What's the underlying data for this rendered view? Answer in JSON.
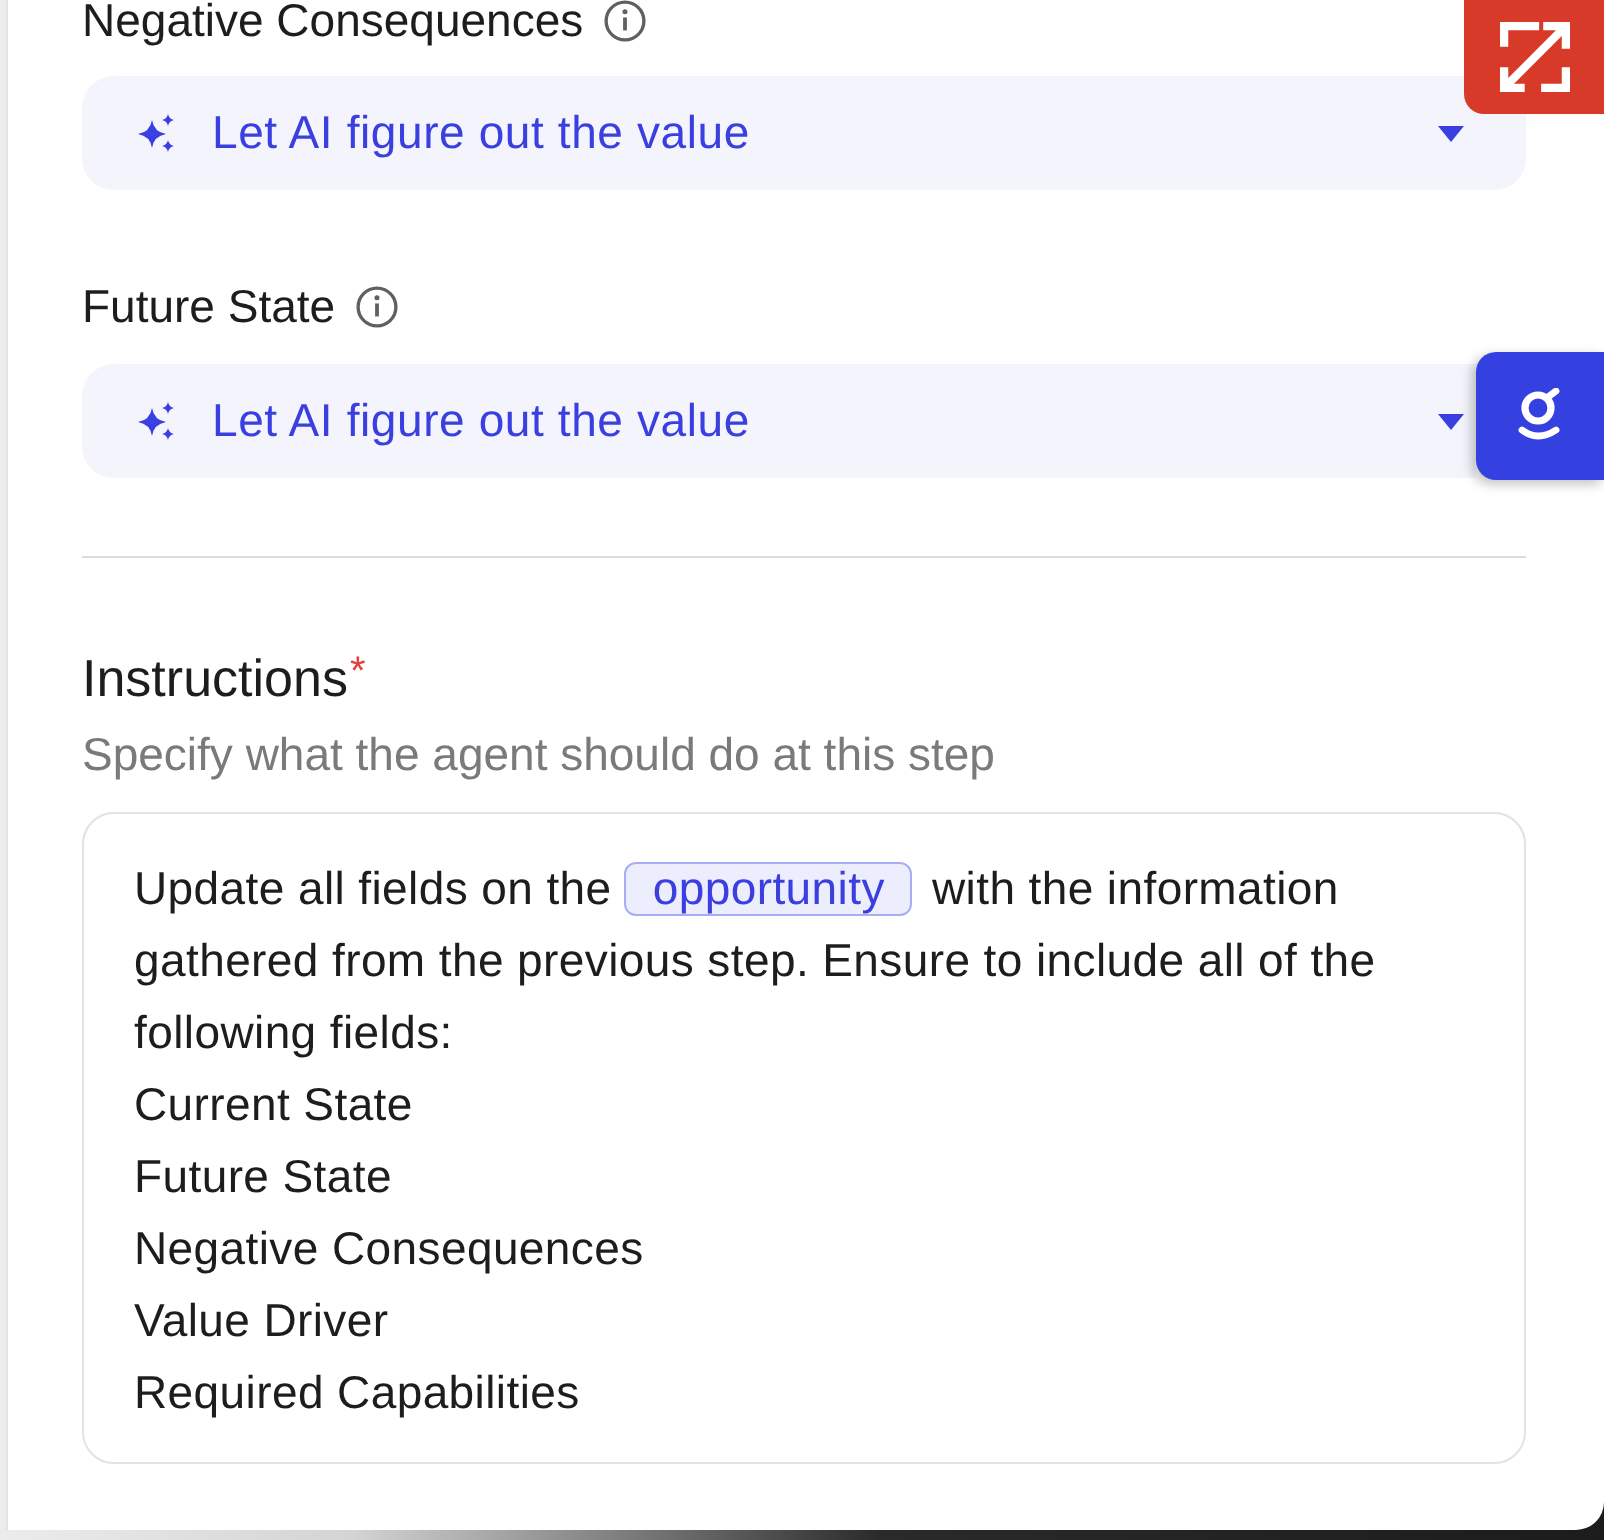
{
  "fields": [
    {
      "label": "Negative Consequences",
      "value": "Let AI figure out the value"
    },
    {
      "label": "Future State",
      "value": "Let AI figure out the value"
    }
  ],
  "instructions": {
    "title": "Instructions",
    "required_mark": "*",
    "description": "Specify what the agent should do at this step",
    "paragraph": {
      "before": "Update all fields on the",
      "mention": "opportunity",
      "after": "with the information gathered from the previous step. Ensure to include all of the following fields:"
    },
    "lines": [
      "Current State",
      "Future State",
      "Negative Consequences",
      "Value Driver",
      "Required Capabilities"
    ]
  }
}
